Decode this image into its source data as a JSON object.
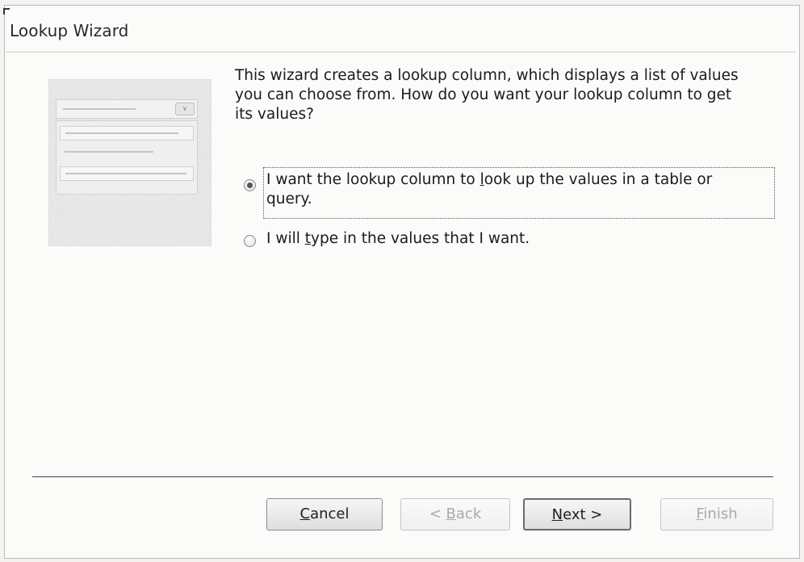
{
  "window": {
    "title": "Lookup Wizard"
  },
  "intro": {
    "line1": "This wizard creates a lookup column, which displays a list of values",
    "line2": "you can choose from.  How do you want your lookup column to get",
    "line3": "its values?"
  },
  "options": [
    {
      "line1_pre": "I want the lookup column to ",
      "line1_acc": "l",
      "line1_post": "ook up the values in a table or",
      "line2": "query.",
      "selected": true
    },
    {
      "pre": "I will ",
      "acc": "t",
      "post": "ype in the values that I want.",
      "selected": false
    }
  ],
  "buttons": {
    "cancel": {
      "acc": "C",
      "rest": "ancel"
    },
    "back": {
      "pre": "< ",
      "acc": "B",
      "rest": "ack",
      "enabled": false
    },
    "next": {
      "acc": "N",
      "rest": "ext >"
    },
    "finish": {
      "acc": "F",
      "rest": "inish",
      "enabled": false
    }
  }
}
